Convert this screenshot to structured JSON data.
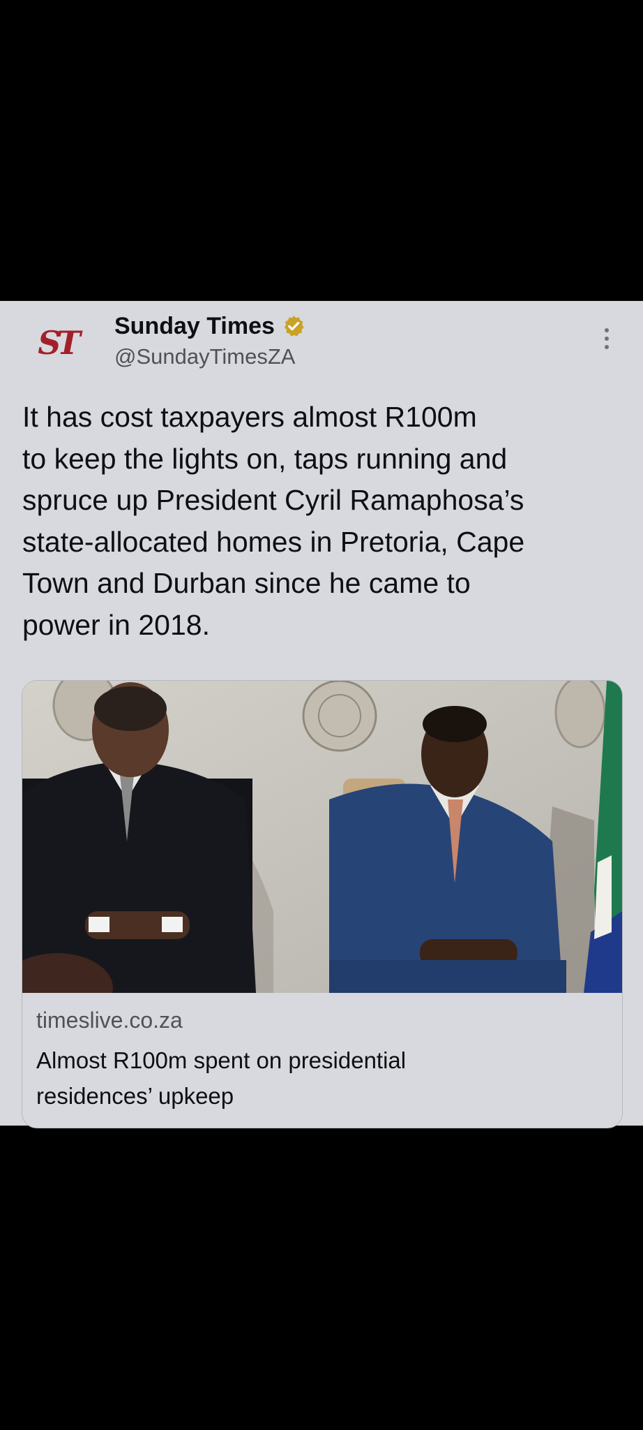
{
  "tweet": {
    "author": {
      "display_name": "Sunday Times",
      "handle": "@SundayTimesZA",
      "logo_text": "ST",
      "verified": true,
      "verified_badge_color": "#c9a227",
      "logo_color": "#a2202a"
    },
    "more_icon": "more-vertical-icon",
    "text": "It has cost taxpayers almost R100m\nto keep the lights on, taps running and\nspruce up President Cyril Ramaphosa’s\nstate-allocated homes in Pretoria, Cape\nTown and Durban since he came to\npower in 2018.",
    "link_card": {
      "domain": "timeslive.co.za",
      "title": "Almost R100m spent on presidential\nresidences’ upkeep"
    }
  },
  "colors": {
    "background": "#000000",
    "card_background": "#d8d9de",
    "primary_text": "#0d0f12",
    "secondary_text": "#4e5257"
  }
}
